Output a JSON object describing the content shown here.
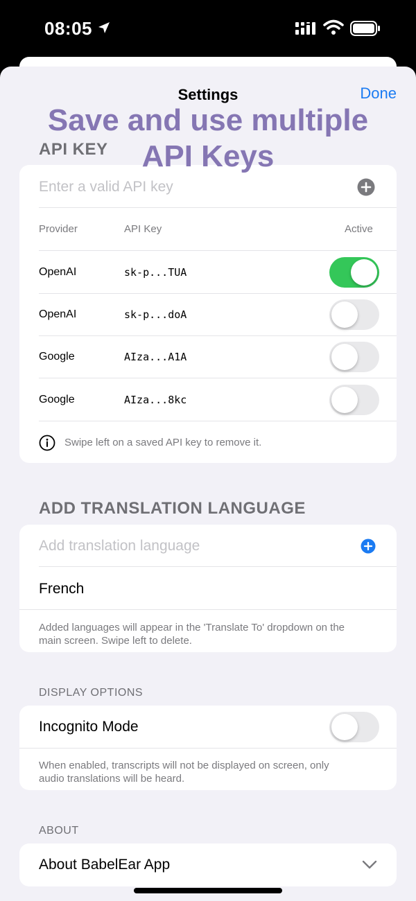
{
  "status_bar": {
    "time": "08:05"
  },
  "nav": {
    "title": "Settings",
    "done_label": "Done"
  },
  "overlay": {
    "line1": "Save and use multiple",
    "line2": "API Keys"
  },
  "api_key": {
    "section_title": "API KEY",
    "input_placeholder": "Enter a valid API key",
    "columns": {
      "provider": "Provider",
      "api_key": "API Key",
      "active": "Active"
    },
    "rows": [
      {
        "provider": "OpenAI",
        "key": "sk-p...TUA",
        "active": true
      },
      {
        "provider": "OpenAI",
        "key": "sk-p...doA",
        "active": false
      },
      {
        "provider": "Google",
        "key": "AIza...A1A",
        "active": false
      },
      {
        "provider": "Google",
        "key": "AIza...8kc",
        "active": false
      }
    ],
    "info_text": "Swipe left on a saved API key to remove it."
  },
  "translation": {
    "section_title": "ADD TRANSLATION LANGUAGE",
    "input_placeholder": "Add translation language",
    "languages": [
      "French"
    ],
    "note_line1": "Added languages will appear in the 'Translate To' dropdown on the",
    "note_line2": "main screen. Swipe left to delete."
  },
  "display": {
    "section_title": "DISPLAY OPTIONS",
    "incognito_label": "Incognito Mode",
    "incognito_on": false,
    "note_line1": "When enabled, transcripts will not be displayed on screen, only",
    "note_line2": "audio translations will be heard."
  },
  "about": {
    "section_title": "ABOUT",
    "item_label": "About BabelEar App"
  },
  "colors": {
    "accent": "#1b7bf2",
    "toggle_on": "#34c759",
    "overlay": "#8576b3",
    "background": "#f2f1f7"
  }
}
